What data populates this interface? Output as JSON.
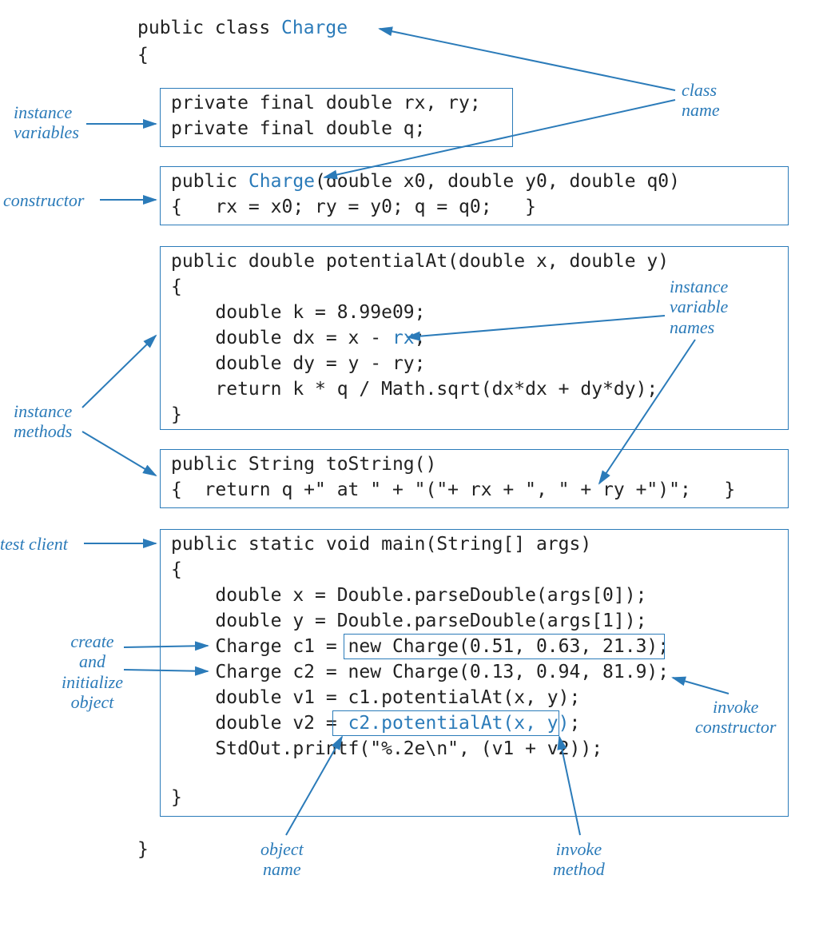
{
  "code": {
    "classdecl_prefix": "public class ",
    "classname": "Charge",
    "open_brace": "{",
    "close_brace": "}",
    "ivars_line1": "private final double rx, ry;",
    "ivars_line2": "private final double q;",
    "ctor_prefix": "public ",
    "ctor_name": "Charge",
    "ctor_params": "(double x0, double y0, double q0)",
    "ctor_body": "{   rx = x0; ry = y0; q = q0;   }",
    "potential_sig": "public double potentialAt(double x, double y)",
    "potential_open": "{",
    "potential_l1a": "    double k = 8.99e09;",
    "potential_l2a": "    double dx = x - ",
    "potential_l2b": "rx",
    "potential_l2c": ";",
    "potential_l3": "    double dy = y - ry;",
    "potential_l4": "    return k * q / Math.sqrt(dx*dx + dy*dy);",
    "potential_close": "}",
    "tostring_sig": "public String toString()",
    "tostring_body": "{  return q +\" at \" + \"(\"+ rx + \", \" + ry +\")\";   }",
    "main_sig": "public static void main(String[] args)",
    "main_open": "{",
    "main_l1": "    double x = Double.parseDouble(args[0]);",
    "main_l2": "    double y = Double.parseDouble(args[1]);",
    "main_l3a": "    Charge c1 = ",
    "main_l3b": "new Charge(0.51, 0.63, 21.3);",
    "main_l4": "    Charge c2 = new Charge(0.13, 0.94, 81.9);",
    "main_l5a": "    double v1 = c1.potentialAt(x, y);",
    "main_l6a": "    double v2 = ",
    "main_l6b": "c2.potentialAt(x, y)",
    "main_l6c": ";",
    "main_l7": "    StdOut.printf(\"%.2e\\n\", (v1 + v2));",
    "main_close": "}"
  },
  "labels": {
    "class_name": "class\nname",
    "instance_variables": "instance\nvariables",
    "constructor": "constructor",
    "instance_methods": "instance\nmethods",
    "instance_variable_names": "instance\nvariable\nnames",
    "test_client": "test client",
    "create_and_initialize": "create\nand\ninitialize\nobject",
    "invoke_constructor": "invoke\nconstructor",
    "object_name": "object\nname",
    "invoke_method": "invoke\nmethod"
  },
  "colors": {
    "accent": "#2b7bb9",
    "text": "#222222"
  }
}
